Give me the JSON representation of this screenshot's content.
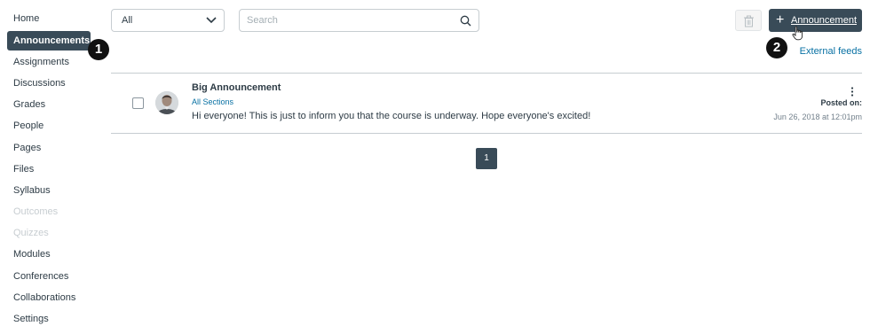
{
  "sidebar": {
    "items": [
      {
        "label": "Home",
        "state": "normal"
      },
      {
        "label": "Announcements",
        "state": "active"
      },
      {
        "label": "Assignments",
        "state": "normal"
      },
      {
        "label": "Discussions",
        "state": "normal"
      },
      {
        "label": "Grades",
        "state": "normal"
      },
      {
        "label": "People",
        "state": "normal"
      },
      {
        "label": "Pages",
        "state": "normal"
      },
      {
        "label": "Files",
        "state": "normal"
      },
      {
        "label": "Syllabus",
        "state": "normal"
      },
      {
        "label": "Outcomes",
        "state": "disabled"
      },
      {
        "label": "Quizzes",
        "state": "disabled"
      },
      {
        "label": "Modules",
        "state": "normal"
      },
      {
        "label": "Conferences",
        "state": "normal"
      },
      {
        "label": "Collaborations",
        "state": "normal"
      },
      {
        "label": "Settings",
        "state": "normal"
      }
    ]
  },
  "callouts": [
    "1",
    "2"
  ],
  "toolbar": {
    "filter_value": "All",
    "search_placeholder": "Search",
    "add_label": "Announcement",
    "add_icon": "plus-icon",
    "delete_icon": "trash-icon"
  },
  "external_feeds": "External feeds",
  "announcement": {
    "title": "Big Announcement",
    "sections": "All Sections",
    "body": "Hi everyone! This is just to inform you that the course is underway. Hope everyone's excited!",
    "posted_label": "Posted on:",
    "posted_date": "Jun 26, 2018 at 12:01pm"
  },
  "pagination": {
    "current": "1"
  },
  "colors": {
    "accent_dark": "#394b58",
    "link": "#0770a3",
    "text": "#2d3b45",
    "disabled": "#c7cdd1"
  }
}
